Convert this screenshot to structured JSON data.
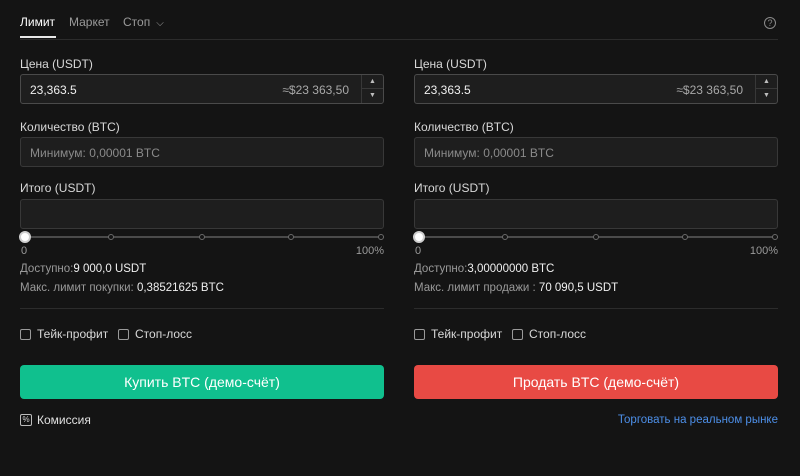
{
  "tabs": {
    "limit": "Лимит",
    "market": "Маркет",
    "stop": "Стоп",
    "help": "?"
  },
  "buy": {
    "price_label": "Цена (USDT)",
    "price_value": "23,363.5",
    "price_approx": "≈$23 363,50",
    "qty_label": "Количество (BTC)",
    "qty_placeholder": "Минимум: 0,00001 BTC",
    "total_label": "Итого (USDT)",
    "slider_min": "0",
    "slider_max": "100%",
    "slider_percent": 0,
    "available_label": "Доступно:",
    "available_value": "9 000,0 USDT",
    "max_label": "Макс. лимит покупки:",
    "max_value": "0,38521625 BTC",
    "take_profit": "Тейк-профит",
    "stop_loss": "Стоп-лосс",
    "action": "Купить BTC (демо-счёт)",
    "fee": "Комиссия"
  },
  "sell": {
    "price_label": "Цена (USDT)",
    "price_value": "23,363.5",
    "price_approx": "≈$23 363,50",
    "qty_label": "Количество (BTC)",
    "qty_placeholder": "Минимум: 0,00001 BTC",
    "total_label": "Итого (USDT)",
    "slider_min": "0",
    "slider_max": "100%",
    "slider_percent": 0,
    "available_label": "Доступно:",
    "available_value": "3,00000000 BTC",
    "max_label": "Макс. лимит продажи :",
    "max_value": "70 090,5 USDT",
    "take_profit": "Тейк-профит",
    "stop_loss": "Стоп-лосс",
    "action": "Продать BTC (демо-счёт)",
    "real_market": "Торговать на реальном рынке"
  },
  "colors": {
    "buy": "#10c08e",
    "sell": "#e84a44",
    "link": "#4d8fe8"
  }
}
